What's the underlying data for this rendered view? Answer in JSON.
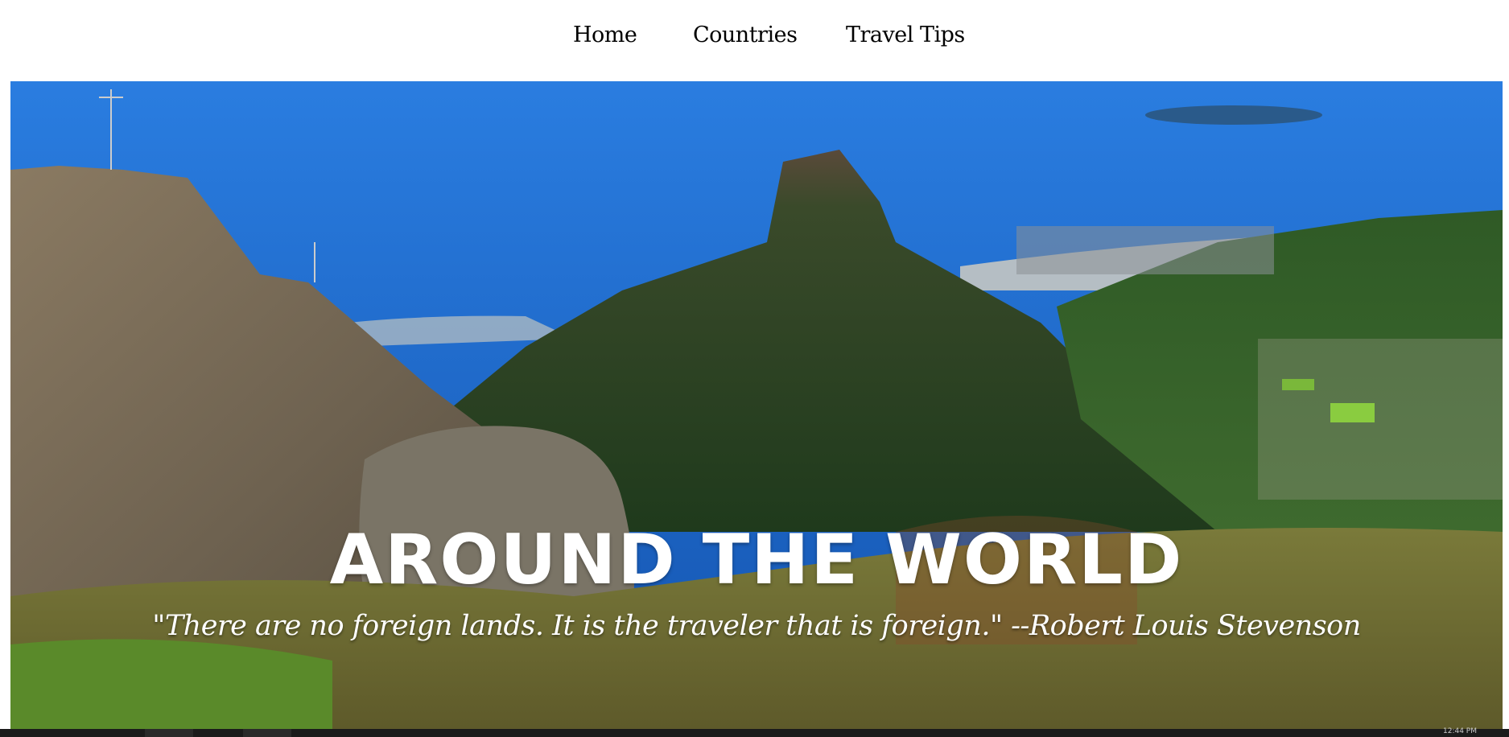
{
  "nav": {
    "items": [
      {
        "label": "Home"
      },
      {
        "label": "Countries"
      },
      {
        "label": "Travel Tips"
      }
    ]
  },
  "hero": {
    "title": "AROUND THE WORLD",
    "quote": "\"There are no foreign lands. It is the traveler that is foreign.\" --Robert Louis Stevenson"
  },
  "taskbar": {
    "clock": "12:44 PM"
  },
  "colors": {
    "nav_text": "#000000",
    "hero_text": "#ffffff",
    "ocean": "#1a62c0",
    "mountain": "#2f5424"
  }
}
